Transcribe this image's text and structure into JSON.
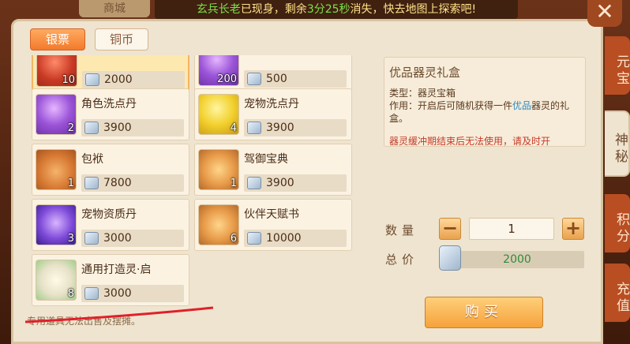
{
  "window": {
    "title": "商城"
  },
  "notice": {
    "part1": "玄兵长老",
    "part2": "已现身，剩余",
    "part3": "3分25秒",
    "part4": "消失，快去地图上探索吧!"
  },
  "currency_tabs": [
    {
      "label": "银票",
      "active": true
    },
    {
      "label": "铜币",
      "active": false
    }
  ],
  "items": [
    {
      "name": "",
      "count": "10",
      "price": "2000",
      "selected": true,
      "icon": "red-gift-icon"
    },
    {
      "name": "",
      "count": "200",
      "price": "500",
      "selected": false,
      "icon": "purple-potion-icon"
    },
    {
      "name": "角色洗点丹",
      "count": "2",
      "price": "3900",
      "selected": false,
      "icon": "purple-orb-icon"
    },
    {
      "name": "宠物洗点丹",
      "count": "4",
      "price": "3900",
      "selected": false,
      "icon": "yellow-orb-icon"
    },
    {
      "name": "包袱",
      "count": "1",
      "price": "7800",
      "selected": false,
      "icon": "bag-icon"
    },
    {
      "name": "驾御宝典",
      "count": "1",
      "price": "3900",
      "selected": false,
      "icon": "book-icon"
    },
    {
      "name": "宠物资质丹",
      "count": "3",
      "price": "3000",
      "selected": false,
      "icon": "purple-crystal-orb-icon"
    },
    {
      "name": "伙伴天赋书",
      "count": "6",
      "price": "10000",
      "selected": false,
      "icon": "talent-book-icon"
    },
    {
      "name": "通用打造灵·启",
      "count": "8",
      "price": "3000",
      "selected": false,
      "icon": "forge-scroll-icon"
    }
  ],
  "detail": {
    "title": "优品器灵礼盒",
    "type": "类型：器灵宝箱",
    "desc_prefix": "作用：开启后可随机获得一件",
    "desc_highlight": "优品",
    "desc_suffix": "器灵的礼盒。",
    "warning": "器灵缓冲期结束后无法使用，请及时开"
  },
  "purchase": {
    "qty_label": "数量",
    "qty_value": "1",
    "total_label": "总价",
    "total_value": "2000",
    "buy_label": "购买"
  },
  "footer_note": "专用道具无法出售及摆摊。",
  "side_tabs": [
    {
      "label": "元宝",
      "active": false
    },
    {
      "label": "神秘",
      "active": true
    },
    {
      "label": "积分",
      "active": false
    },
    {
      "label": "充值",
      "active": false
    }
  ],
  "colors": {
    "accent_orange": "#f27a2c",
    "highlight_blue": "#2a8ac8",
    "warning_red": "#c63a2a",
    "price_green": "#2e8c3a"
  }
}
